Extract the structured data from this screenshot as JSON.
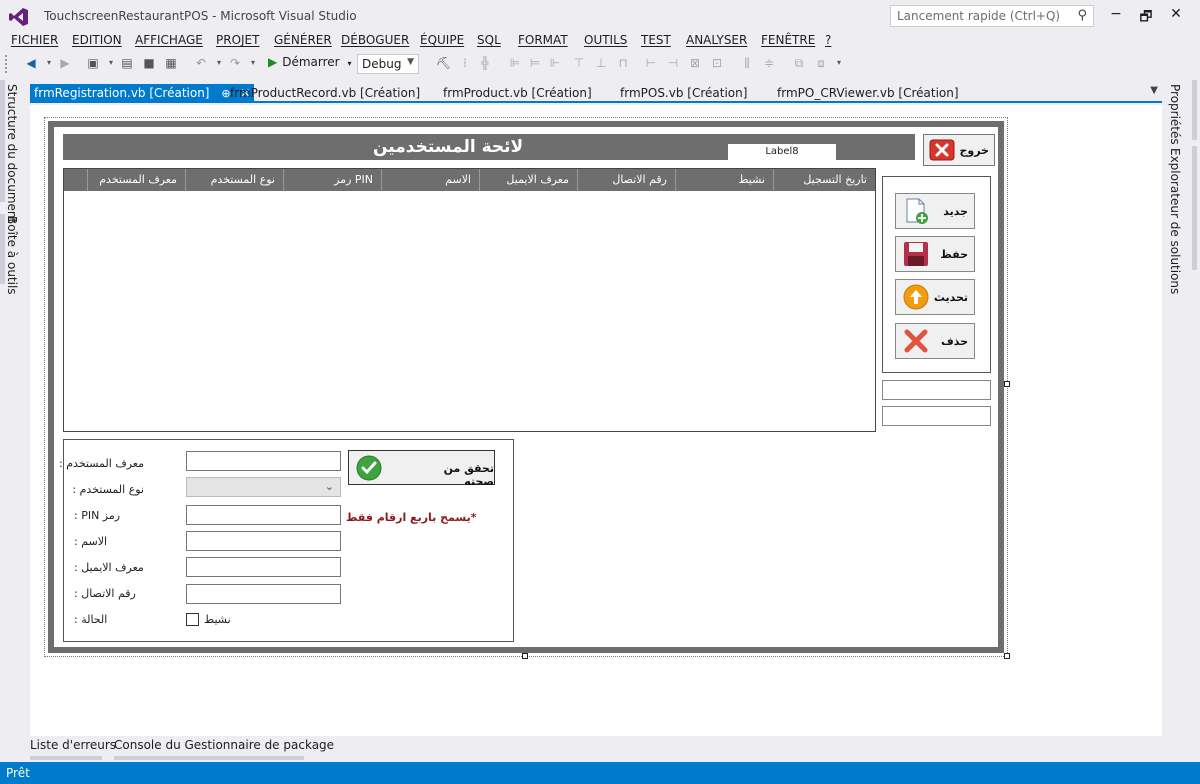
{
  "window": {
    "title": "TouchscreenRestaurantPOS - Microsoft Visual Studio",
    "quick_launch_placeholder": "Lancement rapide (Ctrl+Q)",
    "minimize": "−",
    "restore": "🗗",
    "close": "✕"
  },
  "menu": [
    "FICHIER",
    "EDITION",
    "AFFICHAGE",
    "PROJET",
    "GÉNÉRER",
    "DÉBOGUER",
    "ÉQUIPE",
    "SQL",
    "FORMAT",
    "OUTILS",
    "TEST",
    "ANALYSER",
    "FENÊTRE",
    "?"
  ],
  "toolbar": {
    "start_label": "Démarrer",
    "config_value": "Debug"
  },
  "left_tabs": [
    "Structure du document",
    "Boîte à outils"
  ],
  "right_tabs": [
    "Propriétés",
    "Explorateur de solutions"
  ],
  "doc_tabs": [
    {
      "label": "frmRegistration.vb [Création]",
      "active": true
    },
    {
      "label": "frmProductRecord.vb [Création]",
      "active": false
    },
    {
      "label": "frmProduct.vb [Création]",
      "active": false
    },
    {
      "label": "frmPOS.vb [Création]",
      "active": false
    },
    {
      "label": "frmPO_CRViewer.vb [Création]",
      "active": false
    }
  ],
  "form": {
    "header_title": "لائحة المستخدمين",
    "label8": "Label8",
    "exit_label": "خروج",
    "grid_columns": [
      "تاريخ التسجيل",
      "نشيط",
      "رقم الاتصال",
      "معرف الايميل",
      "الاسم",
      "PIN رمز",
      "نوع المستخدم",
      "معرف المستخدم"
    ],
    "side_buttons": {
      "new": "جديد",
      "save": "حفظ",
      "update": "تحديث",
      "delete": "حذف"
    },
    "fields": {
      "user_id": "معرف المستخدم :",
      "user_type": "نوع المستخدم :",
      "pin": "رمز PIN :",
      "name": "الاسم :",
      "email": "معرف الايميل :",
      "contact": "رقم الاتصال :",
      "status": "الحالة :"
    },
    "verify_label": "تحقق من صحته",
    "pin_note": "*يسمح باربع ارقام فقط",
    "active_label": "نشيط"
  },
  "bottom_tabs": [
    "Liste d'erreurs",
    "Console du Gestionnaire de package"
  ],
  "status": "Prêt",
  "colors": {
    "accent": "#007acc",
    "form_frame": "#6e6e6e",
    "pin_note": "#8b1a1a",
    "exit_red": "#d9362b",
    "verify_green": "#3fa33f"
  }
}
